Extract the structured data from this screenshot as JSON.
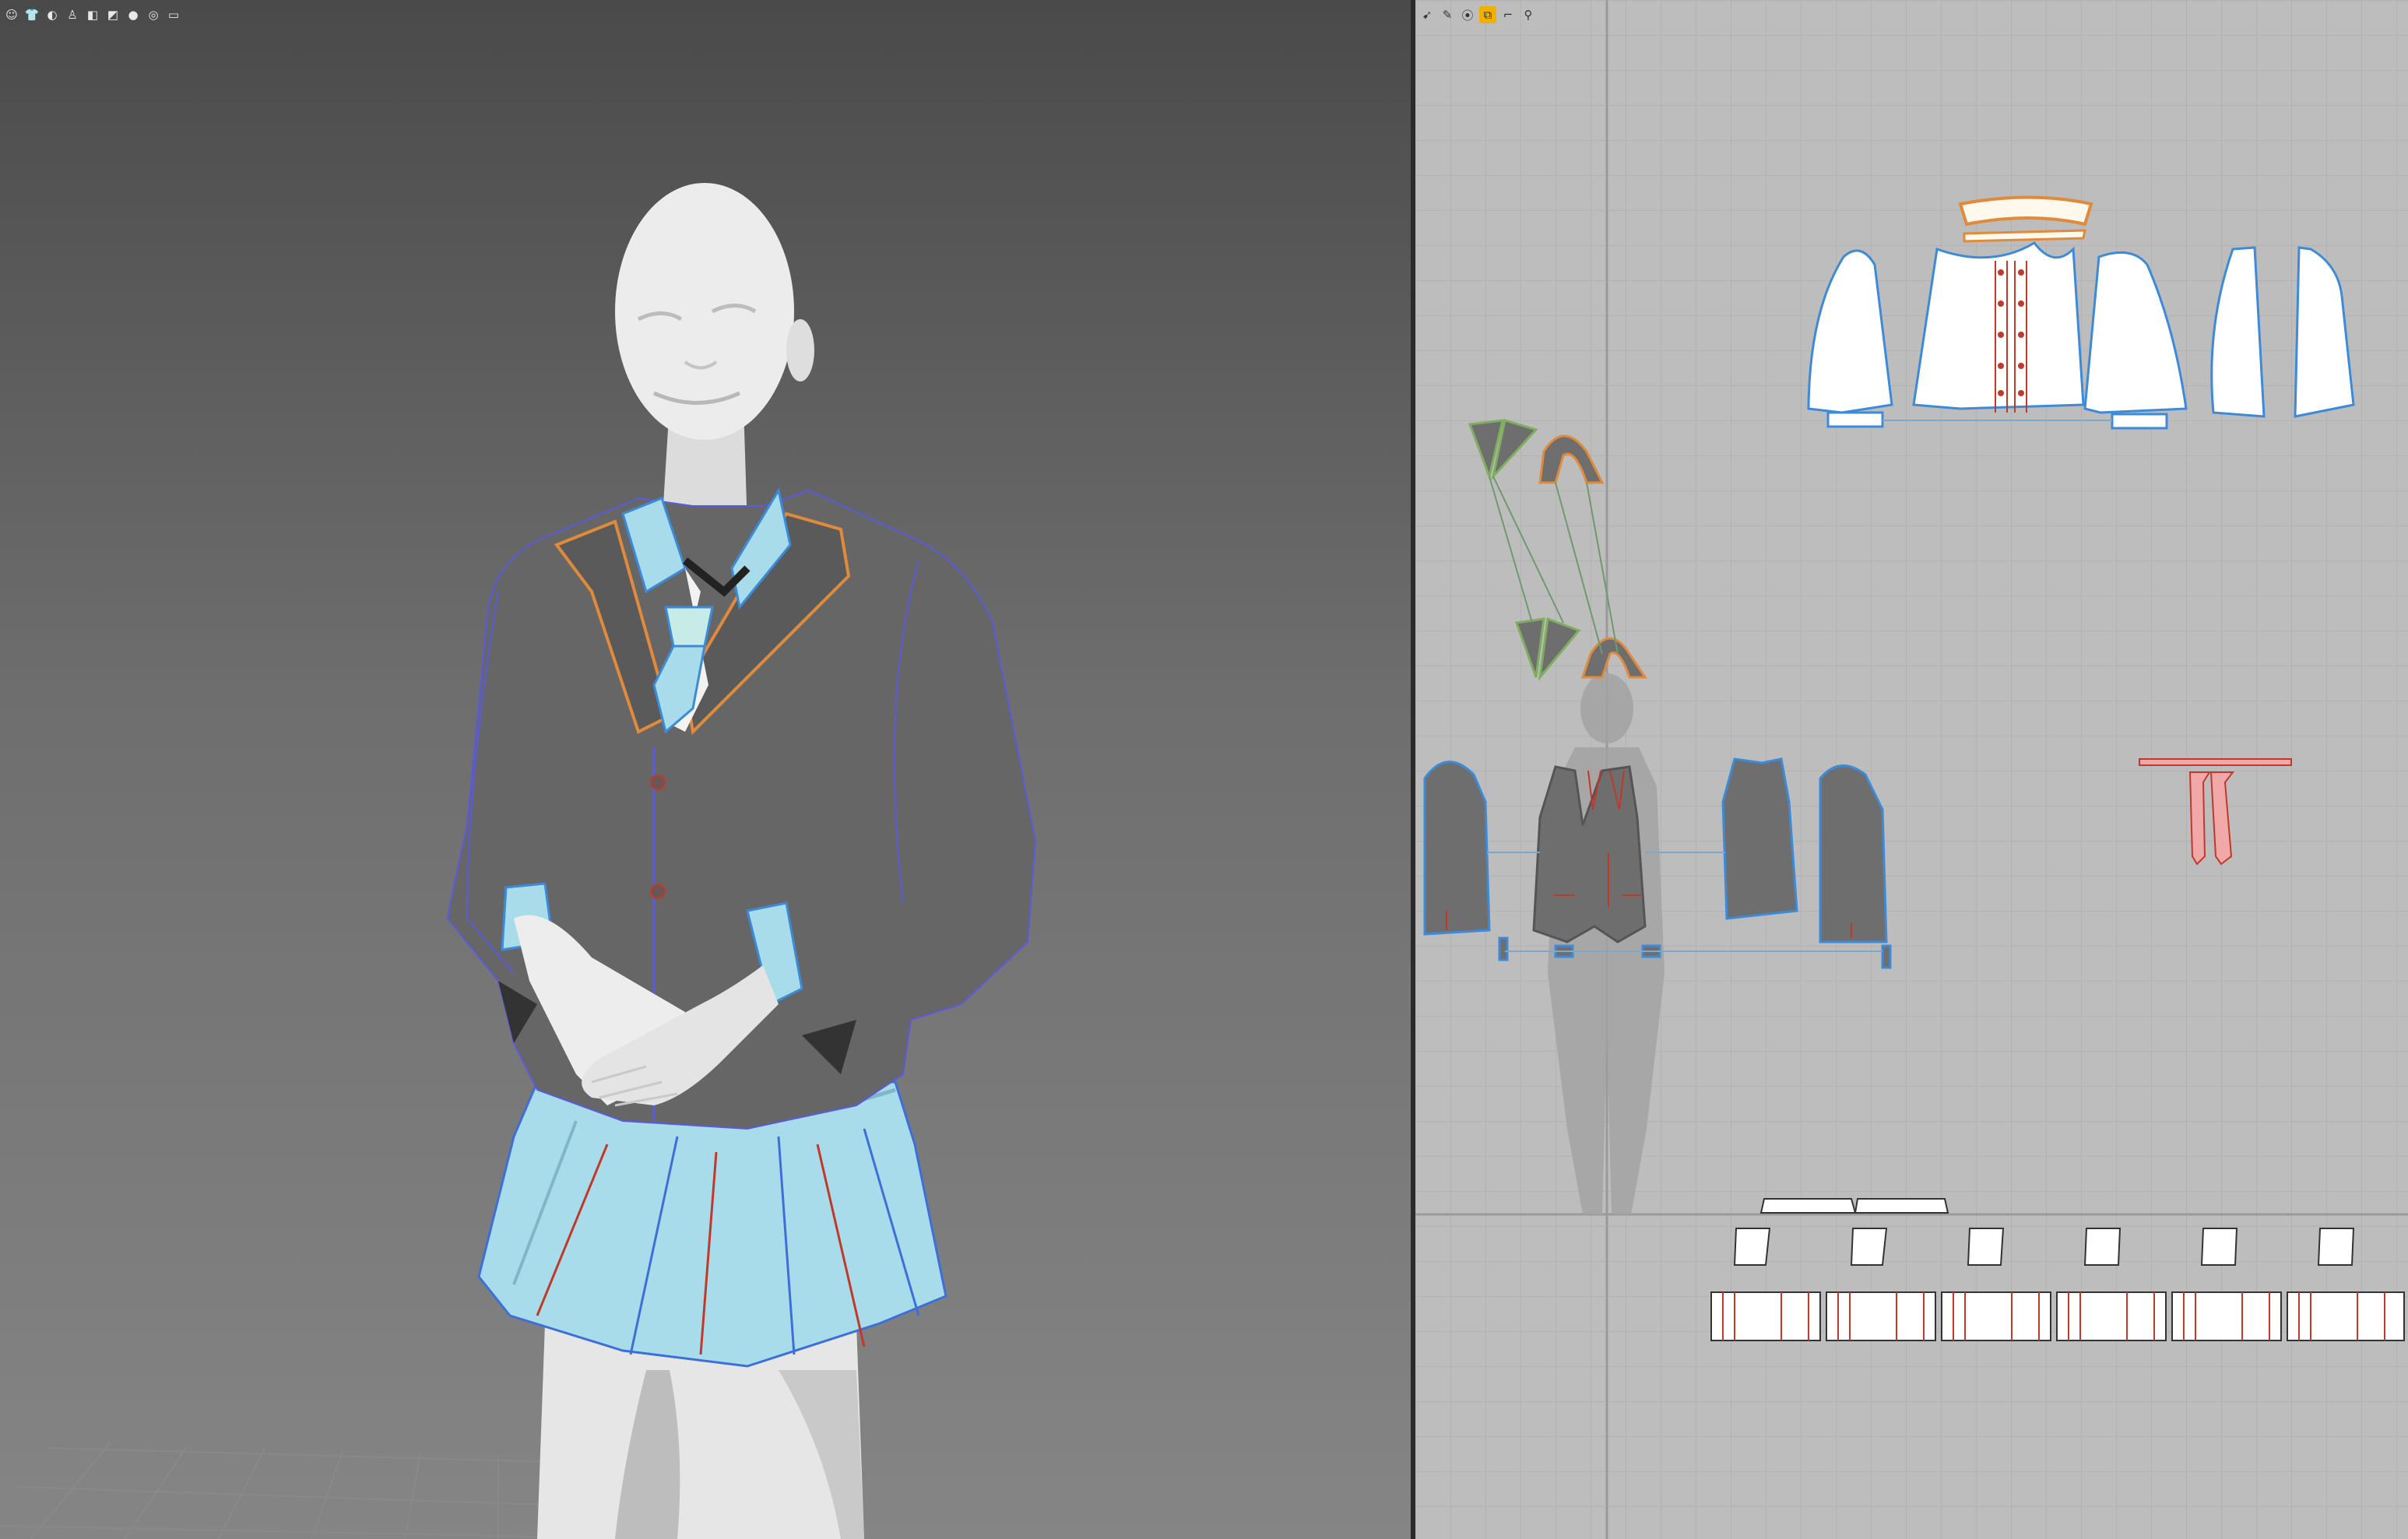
{
  "viewport3d": {
    "toolbar": [
      {
        "icon": "avatar-show-icon"
      },
      {
        "icon": "garment-show-icon"
      },
      {
        "icon": "texture-icon"
      },
      {
        "icon": "avatar-pose-icon"
      },
      {
        "icon": "shading-icon"
      },
      {
        "icon": "render-mode-icon"
      },
      {
        "icon": "skin-icon"
      },
      {
        "icon": "measure-icon"
      },
      {
        "icon": "floor-icon"
      }
    ]
  },
  "viewport2d": {
    "toolbar": [
      {
        "icon": "transform-pattern-icon"
      },
      {
        "icon": "edit-pattern-icon"
      },
      {
        "icon": "sewing-icon"
      },
      {
        "icon": "segment-sewing-icon",
        "active": true
      },
      {
        "icon": "internal-line-icon"
      },
      {
        "icon": "pin-icon"
      }
    ]
  },
  "colors": {
    "jacket": "#666666",
    "shirt": "#ffffff",
    "tie": "#f0a8a8",
    "skirt": "#a8dcea",
    "selected_outline": "#3d8bd8",
    "seam_red": "#c0392b",
    "collar_orange": "#e08a3c",
    "tool_active": "#f0b000"
  }
}
